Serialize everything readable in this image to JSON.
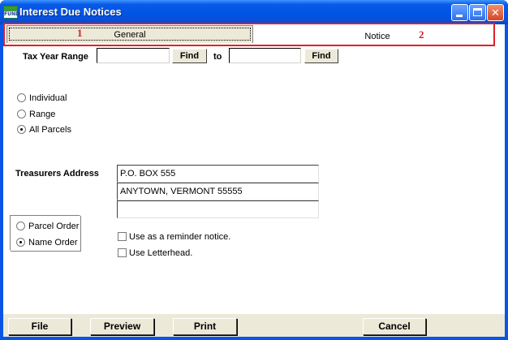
{
  "window": {
    "title": "Interest Due Notices",
    "icon_text": "FUND",
    "icon_name": "fund-app-icon",
    "controls": [
      "minimize-icon",
      "maximize-icon",
      "close-icon"
    ]
  },
  "tabs": [
    {
      "label": "General",
      "selected": true
    },
    {
      "label": "Notice",
      "selected": false
    }
  ],
  "callouts": [
    "1",
    "2"
  ],
  "tax_year_range": {
    "label": "Tax Year Range",
    "from_value": "",
    "to_label": "to",
    "to_value": "",
    "find_label": "Find"
  },
  "selection": {
    "options": [
      "Individual",
      "Range",
      "All Parcels"
    ],
    "selected": "All Parcels"
  },
  "treasurers_address": {
    "label": "Treasurers Address",
    "lines": [
      "P.O. BOX 555",
      "ANYTOWN, VERMONT 55555",
      ""
    ]
  },
  "order": {
    "options": [
      "Parcel Order",
      "Name Order"
    ],
    "selected": "Name Order"
  },
  "options": {
    "reminder_label": "Use as a reminder notice.",
    "reminder_checked": false,
    "letterhead_label": "Use Letterhead.",
    "letterhead_checked": false
  },
  "buttons": {
    "file": "File",
    "preview": "Preview",
    "print": "Print",
    "cancel": "Cancel"
  },
  "colors": {
    "titlebar": "#0055e5",
    "callout_red": "#e0202a",
    "button_face": "#ece9d8"
  }
}
